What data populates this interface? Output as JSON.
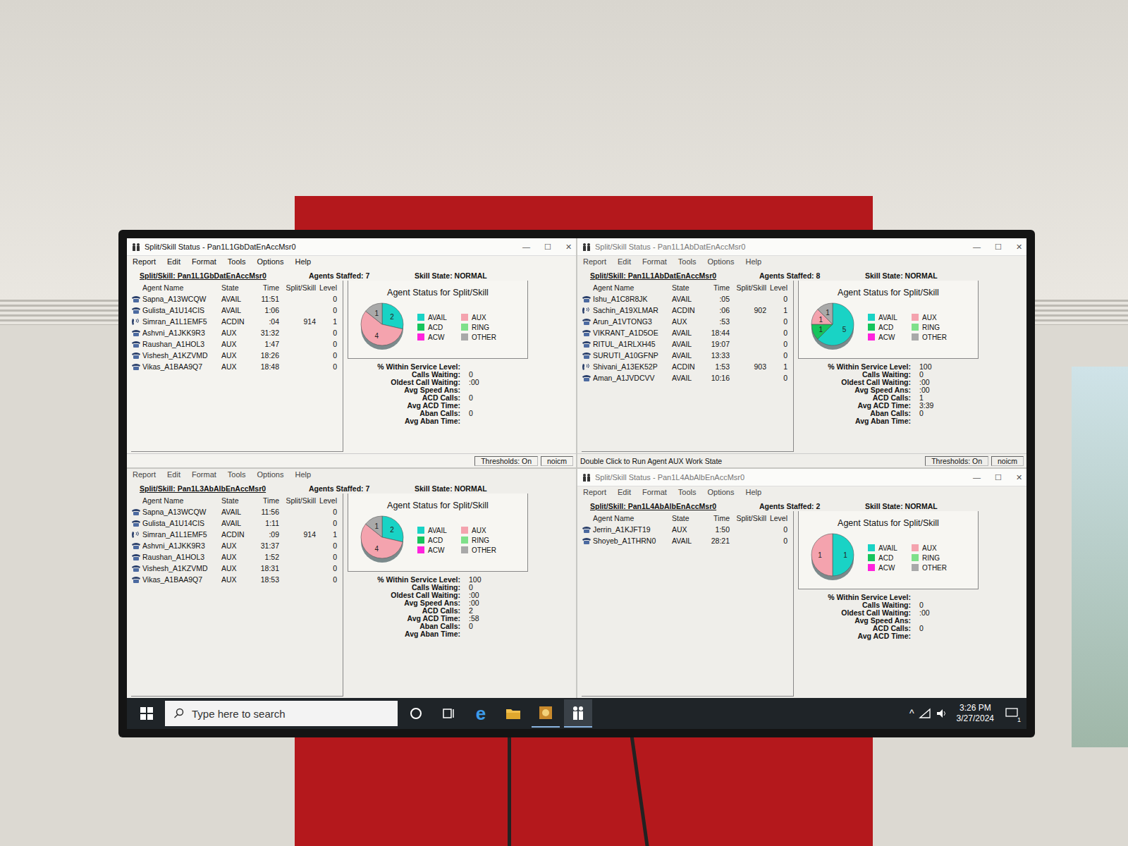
{
  "window_controls": [
    "—",
    "☐",
    "✕"
  ],
  "menu": [
    "Report",
    "Edit",
    "Format",
    "Tools",
    "Options",
    "Help"
  ],
  "columns": [
    "Agent Name",
    "State",
    "Time",
    "Split/Skill",
    "Level"
  ],
  "legend": [
    {
      "label": "AVAIL",
      "color": "#19d3c5"
    },
    {
      "label": "AUX",
      "color": "#f4a3ae"
    },
    {
      "label": "ACD",
      "color": "#16c45c"
    },
    {
      "label": "RING",
      "color": "#7fe08a"
    },
    {
      "label": "ACW",
      "color": "#ff22dd"
    },
    {
      "label": "OTHER",
      "color": "#a9a9a9"
    }
  ],
  "windows": [
    {
      "title": "Split/Skill Status - Pan1L1GbDatEnAccMsr0",
      "active": true,
      "skill": "Split/Skill:  Pan1L1GbDatEnAccMsr0",
      "staffed": "Agents Staffed: 7",
      "state": "Skill State:  NORMAL",
      "agents": [
        {
          "name": "Sapna_A13WCQW",
          "state": "AVAIL",
          "time": "11:51",
          "split": "",
          "level": "0",
          "on_call": false
        },
        {
          "name": "Gulista_A1U14CIS",
          "state": "AVAIL",
          "time": "1:06",
          "split": "",
          "level": "0",
          "on_call": false
        },
        {
          "name": "Simran_A1L1EMF5",
          "state": "ACDIN",
          "time": ":04",
          "split": "914",
          "level": "1",
          "on_call": true
        },
        {
          "name": "Ashvni_A1JKK9R3",
          "state": "AUX",
          "time": "31:32",
          "split": "",
          "level": "0",
          "on_call": false
        },
        {
          "name": "Raushan_A1HOL3",
          "state": "AUX",
          "time": "1:47",
          "split": "",
          "level": "0",
          "on_call": false
        },
        {
          "name": "Vishesh_A1KZVMD",
          "state": "AUX",
          "time": "18:26",
          "split": "",
          "level": "0",
          "on_call": false
        },
        {
          "name": "Vikas_A1BAA9Q7",
          "state": "AUX",
          "time": "18:48",
          "split": "",
          "level": "0",
          "on_call": false
        }
      ],
      "chart_title": "Agent Status for Split/Skill",
      "pie": [
        {
          "label": "2",
          "value": 2,
          "color": "#19d3c5"
        },
        {
          "label": "4",
          "value": 4,
          "color": "#f4a3ae"
        },
        {
          "label": "1",
          "value": 1,
          "color": "#a9a9a9"
        }
      ],
      "stats": [
        {
          "label": "% Within Service Level:",
          "value": ""
        },
        {
          "label": "Calls Waiting:",
          "value": "0"
        },
        {
          "label": "Oldest Call Waiting:",
          "value": ":00"
        },
        {
          "label": "Avg Speed Ans:",
          "value": ""
        },
        {
          "label": "ACD Calls:",
          "value": "0"
        },
        {
          "label": "Avg ACD Time:",
          "value": ""
        },
        {
          "label": "Aban Calls:",
          "value": "0"
        },
        {
          "label": "Avg Aban Time:",
          "value": ""
        }
      ],
      "status": [
        "",
        "Thresholds: On",
        "noicm"
      ]
    },
    {
      "title": "Split/Skill Status - Pan1L1AbDatEnAccMsr0",
      "active": false,
      "skill": "Split/Skill:  Pan1L1AbDatEnAccMsr0",
      "staffed": "Agents Staffed: 8",
      "state": "Skill State:  NORMAL",
      "agents": [
        {
          "name": "Ishu_A1C8R8JK",
          "state": "AVAIL",
          "time": ":05",
          "split": "",
          "level": "0",
          "on_call": false
        },
        {
          "name": "Sachin_A19XLMAR",
          "state": "ACDIN",
          "time": ":06",
          "split": "902",
          "level": "1",
          "on_call": true
        },
        {
          "name": "Arun_A1VTONG3",
          "state": "AUX",
          "time": ":53",
          "split": "",
          "level": "0",
          "on_call": false
        },
        {
          "name": "VIKRANT_A1D5OE",
          "state": "AVAIL",
          "time": "18:44",
          "split": "",
          "level": "0",
          "on_call": false
        },
        {
          "name": "RITUL_A1RLXH45",
          "state": "AVAIL",
          "time": "19:07",
          "split": "",
          "level": "0",
          "on_call": false
        },
        {
          "name": "SURUTI_A10GFNP",
          "state": "AVAIL",
          "time": "13:33",
          "split": "",
          "level": "0",
          "on_call": false
        },
        {
          "name": "Shivani_A13EK52P",
          "state": "ACDIN",
          "time": "1:53",
          "split": "903",
          "level": "1",
          "on_call": true
        },
        {
          "name": "Aman_A1JVDCVV",
          "state": "AVAIL",
          "time": "10:16",
          "split": "",
          "level": "0",
          "on_call": false
        }
      ],
      "chart_title": "Agent Status for Split/Skill",
      "pie": [
        {
          "label": "5",
          "value": 5,
          "color": "#19d3c5"
        },
        {
          "label": "1",
          "value": 1,
          "color": "#16c45c"
        },
        {
          "label": "1",
          "value": 1,
          "color": "#f4a3ae"
        },
        {
          "label": "1",
          "value": 1,
          "color": "#a9a9a9"
        }
      ],
      "stats": [
        {
          "label": "% Within Service Level:",
          "value": "100"
        },
        {
          "label": "Calls Waiting:",
          "value": "0"
        },
        {
          "label": "Oldest Call Waiting:",
          "value": ":00"
        },
        {
          "label": "Avg Speed Ans:",
          "value": ":00"
        },
        {
          "label": "ACD Calls:",
          "value": "1"
        },
        {
          "label": "Avg ACD Time:",
          "value": "3:39"
        },
        {
          "label": "Aban Calls:",
          "value": "0"
        },
        {
          "label": "Avg Aban Time:",
          "value": ""
        }
      ],
      "status": [
        "Double Click to Run Agent AUX Work State",
        "Thresholds: On",
        "noicm"
      ]
    },
    {
      "title": "",
      "active": false,
      "skill": "Split/Skill:  Pan1L3AbAlbEnAccMsr0",
      "staffed": "Agents Staffed: 7",
      "state": "Skill State:  NORMAL",
      "agents": [
        {
          "name": "Sapna_A13WCQW",
          "state": "AVAIL",
          "time": "11:56",
          "split": "",
          "level": "0",
          "on_call": false
        },
        {
          "name": "Gulista_A1U14CIS",
          "state": "AVAIL",
          "time": "1:11",
          "split": "",
          "level": "0",
          "on_call": false
        },
        {
          "name": "Simran_A1L1EMF5",
          "state": "ACDIN",
          "time": ":09",
          "split": "914",
          "level": "1",
          "on_call": true
        },
        {
          "name": "Ashvni_A1JKK9R3",
          "state": "AUX",
          "time": "31:37",
          "split": "",
          "level": "0",
          "on_call": false
        },
        {
          "name": "Raushan_A1HOL3",
          "state": "AUX",
          "time": "1:52",
          "split": "",
          "level": "0",
          "on_call": false
        },
        {
          "name": "Vishesh_A1KZVMD",
          "state": "AUX",
          "time": "18:31",
          "split": "",
          "level": "0",
          "on_call": false
        },
        {
          "name": "Vikas_A1BAA9Q7",
          "state": "AUX",
          "time": "18:53",
          "split": "",
          "level": "0",
          "on_call": false
        }
      ],
      "chart_title": "Agent Status for Split/Skill",
      "pie": [
        {
          "label": "2",
          "value": 2,
          "color": "#19d3c5"
        },
        {
          "label": "4",
          "value": 4,
          "color": "#f4a3ae"
        },
        {
          "label": "1",
          "value": 1,
          "color": "#a9a9a9"
        }
      ],
      "stats": [
        {
          "label": "% Within Service Level:",
          "value": "100"
        },
        {
          "label": "Calls Waiting:",
          "value": "0"
        },
        {
          "label": "Oldest Call Waiting:",
          "value": ":00"
        },
        {
          "label": "Avg Speed Ans:",
          "value": ":00"
        },
        {
          "label": "ACD Calls:",
          "value": "2"
        },
        {
          "label": "Avg ACD Time:",
          "value": ":58"
        },
        {
          "label": "Aban Calls:",
          "value": "0"
        },
        {
          "label": "Avg Aban Time:",
          "value": ""
        }
      ],
      "status": []
    },
    {
      "title": "Split/Skill Status - Pan1L4AbAlbEnAccMsr0",
      "active": false,
      "skill": "Split/Skill:  Pan1L4AbAlbEnAccMsr0",
      "staffed": "Agents Staffed: 2",
      "state": "Skill State:  NORMAL",
      "agents": [
        {
          "name": "Jerrin_A1KJFT19",
          "state": "AUX",
          "time": "1:50",
          "split": "",
          "level": "0",
          "on_call": false
        },
        {
          "name": "Shoyeb_A1THRN0",
          "state": "AVAIL",
          "time": "28:21",
          "split": "",
          "level": "0",
          "on_call": false
        }
      ],
      "chart_title": "Agent Status for Split/Skill",
      "pie": [
        {
          "label": "1",
          "value": 1,
          "color": "#19d3c5"
        },
        {
          "label": "1",
          "value": 1,
          "color": "#f4a3ae"
        }
      ],
      "stats": [
        {
          "label": "% Within Service Level:",
          "value": ""
        },
        {
          "label": "Calls Waiting:",
          "value": "0"
        },
        {
          "label": "Oldest Call Waiting:",
          "value": ":00"
        },
        {
          "label": "Avg Speed Ans:",
          "value": ""
        },
        {
          "label": "ACD Calls:",
          "value": "0"
        },
        {
          "label": "Avg ACD Time:",
          "value": ""
        }
      ],
      "status": []
    }
  ],
  "taskbar": {
    "search_placeholder": "Type here to search",
    "time": "3:26 PM",
    "date": "3/27/2024",
    "notifications": "1",
    "edge_glyph": "e",
    "tray_glyph": "^"
  }
}
